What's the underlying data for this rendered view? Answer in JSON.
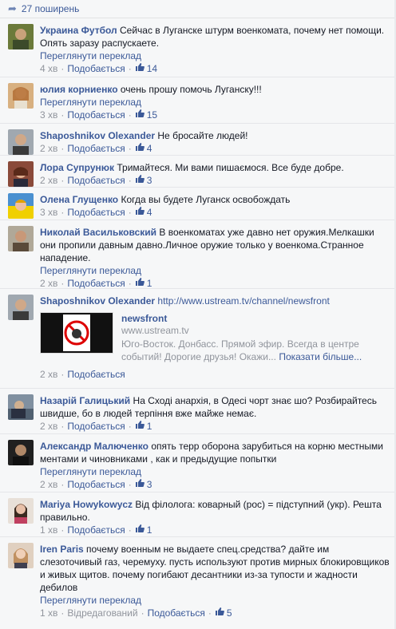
{
  "shares": {
    "icon": "share-arrow-icon",
    "label": "27 поширень"
  },
  "comments": [
    {
      "author": "Украина Футбол",
      "text": "Сейчас в Луганске штурм военкомата, почему нет помощи. Опять заразу распускаете.",
      "translate": "Переглянути переклад",
      "time": "4 хв",
      "like": "Подобається",
      "likes": "14",
      "avatar_color": "#6b7a3a"
    },
    {
      "author": "юлия корниенко",
      "text": "очень прошу помочь Луганску!!!",
      "translate": "Переглянути переклад",
      "time": "3 хв",
      "like": "Подобається",
      "likes": "15",
      "avatar_color": "#c9863c"
    },
    {
      "author": "Shaposhnikov Olexander",
      "text": "Не бросайте людей!",
      "time": "2 хв",
      "like": "Подобається",
      "likes": "4",
      "avatar_color": "#5a5a5a"
    },
    {
      "author": "Лора Супрунюк",
      "text": "Тримайтеся. Ми вами пишаємося. Все буде добре.",
      "time": "2 хв",
      "like": "Подобається",
      "likes": "3",
      "avatar_color": "#8a4a3a"
    },
    {
      "author": "Олена Глущенко",
      "text": "Когда вы будете Луганск освобождать",
      "time": "3 хв",
      "like": "Подобається",
      "likes": "4",
      "avatar_color": "#f0d000"
    },
    {
      "author": "Николай Васильковский",
      "text": "В военкоматах уже давно нет оружия.Мелкашки они пропили давным давно.Личное оружие только у военкома.Странное нападение.",
      "translate": "Переглянути переклад",
      "time": "2 хв",
      "like": "Подобається",
      "likes": "1",
      "avatar_color": "#7a6a5a"
    },
    {
      "author": "Shaposhnikov Olexander",
      "link": "http://www.ustream.tv/channel/newsfront",
      "preview": {
        "title": "newsfront",
        "url": "www.ustream.tv",
        "desc": "Юго-Восток. Донбасс. Прямой эфир. Всегда в центре событий! Дорогие друзья! Окажи...",
        "more": "Показати більше..."
      },
      "time": "2 хв",
      "like": "Подобається",
      "avatar_color": "#5a5a5a"
    },
    {
      "author": "Назарій Галицький",
      "text": "На Сході анархія, в Одесі чорт знає шо? Розбирайтесь швидше, бо в людей терпіння вже майже немає.",
      "time": "2 хв",
      "like": "Подобається",
      "likes": "1",
      "avatar_color": "#6a7a8a"
    },
    {
      "author": "Александр Малюченко",
      "text": "опять терр оборона зарубиться на корню местными ментами и чиновниками , как и предыдущие попытки",
      "translate": "Переглянути переклад",
      "time": "2 хв",
      "like": "Подобається",
      "likes": "3",
      "avatar_color": "#3a3a3a"
    },
    {
      "author": "Mariya Howykowycz",
      "text": "Від філолога: коварный (рос) = підступний (укр). Решта правильно.",
      "time": "1 хв",
      "like": "Подобається",
      "likes": "1",
      "avatar_color": "#b08070"
    },
    {
      "author": "Iren Paris",
      "text": "почему военным не выдаете спец.средства? дайте им слезоточивый газ, черемуху. пусть используют против мирных блокировщиков и живых щитов. почему погибают десантники из-за тупости и жадности дебилов",
      "translate": "Переглянути переклад",
      "time": "1 хв",
      "edited": "Відредагований",
      "like": "Подобається",
      "likes": "5",
      "avatar_color": "#c0a080"
    }
  ],
  "thumb_icon": "thumbs-up-icon",
  "colors": {
    "link": "#3b5998",
    "meta": "#90949c",
    "background": "#f6f7f8"
  }
}
